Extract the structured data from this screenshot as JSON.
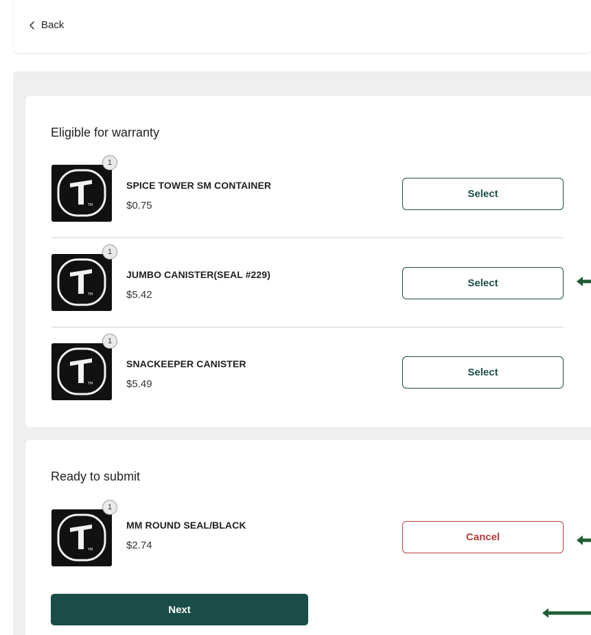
{
  "header": {
    "back_label": "Back"
  },
  "eligible": {
    "title": "Eligible for warranty",
    "select_label": "Select",
    "items": [
      {
        "name": "SPICE TOWER SM CONTAINER",
        "price": "$0.75",
        "qty": "1"
      },
      {
        "name": "JUMBO CANISTER(SEAL #229)",
        "price": "$5.42",
        "qty": "1"
      },
      {
        "name": "SNACKEEPER CANISTER",
        "price": "$5.49",
        "qty": "1"
      }
    ]
  },
  "submit": {
    "title": "Ready to submit",
    "cancel_label": "Cancel",
    "next_label": "Next",
    "items": [
      {
        "name": "MM ROUND SEAL/BLACK",
        "price": "$2.74",
        "qty": "1"
      }
    ]
  },
  "colors": {
    "brand": "#1b4d48",
    "cancel": "#b93a3a",
    "arrow": "#1e5e32",
    "panel_bg": "#efefef"
  },
  "icons": {
    "back": "chevron-left-icon",
    "product": "tupperware-logo-icon",
    "pointer": "arrow-left-icon"
  }
}
